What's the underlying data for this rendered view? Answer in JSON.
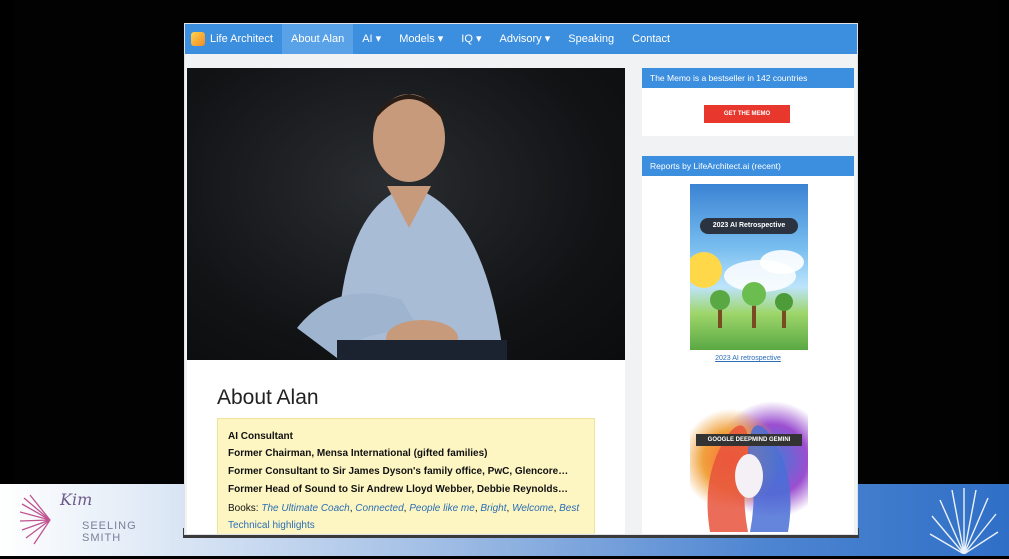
{
  "nav": {
    "logo": "Life Architect",
    "items": [
      "About Alan",
      "AI",
      "Models",
      "IQ",
      "Advisory",
      "Speaking",
      "Contact"
    ],
    "dropdown_marks": [
      "",
      "▾",
      "▾",
      "▾",
      "▾",
      "",
      ""
    ],
    "active": "About Alan"
  },
  "main": {
    "title": "About Alan",
    "highlights": [
      "AI Consultant",
      "Former Chairman, Mensa International (gifted families)",
      "Former Consultant to Sir James Dyson's family office, PwC, Glencore…",
      "Former Head of Sound to Sir Andrew Lloyd Webber, Debbie Reynolds…"
    ],
    "books_label": "Books:",
    "books": [
      "The Ultimate Coach",
      "Connected",
      "People like me",
      "Bright",
      "Welcome",
      "Best"
    ],
    "technical_link": "Technical highlights"
  },
  "sidebar": {
    "memo": {
      "heading": "The Memo is a bestseller in 142 countries",
      "button": "GET THE MEMO"
    },
    "reports": {
      "heading": "Reports by LifeArchitect.ai (recent)",
      "items": [
        {
          "badge": "2023 AI Retrospective",
          "caption": "2023 AI retrospective"
        },
        {
          "badge": "GOOGLE DEEPMIND GEMINI",
          "caption": ""
        }
      ]
    }
  },
  "branding": {
    "name": "Kim",
    "surname": "SEELING",
    "surname2": "SMITH"
  },
  "colors": {
    "nav": "#3c8ede",
    "accent": "#e8372c",
    "highlight_box": "#fdf6c3"
  }
}
